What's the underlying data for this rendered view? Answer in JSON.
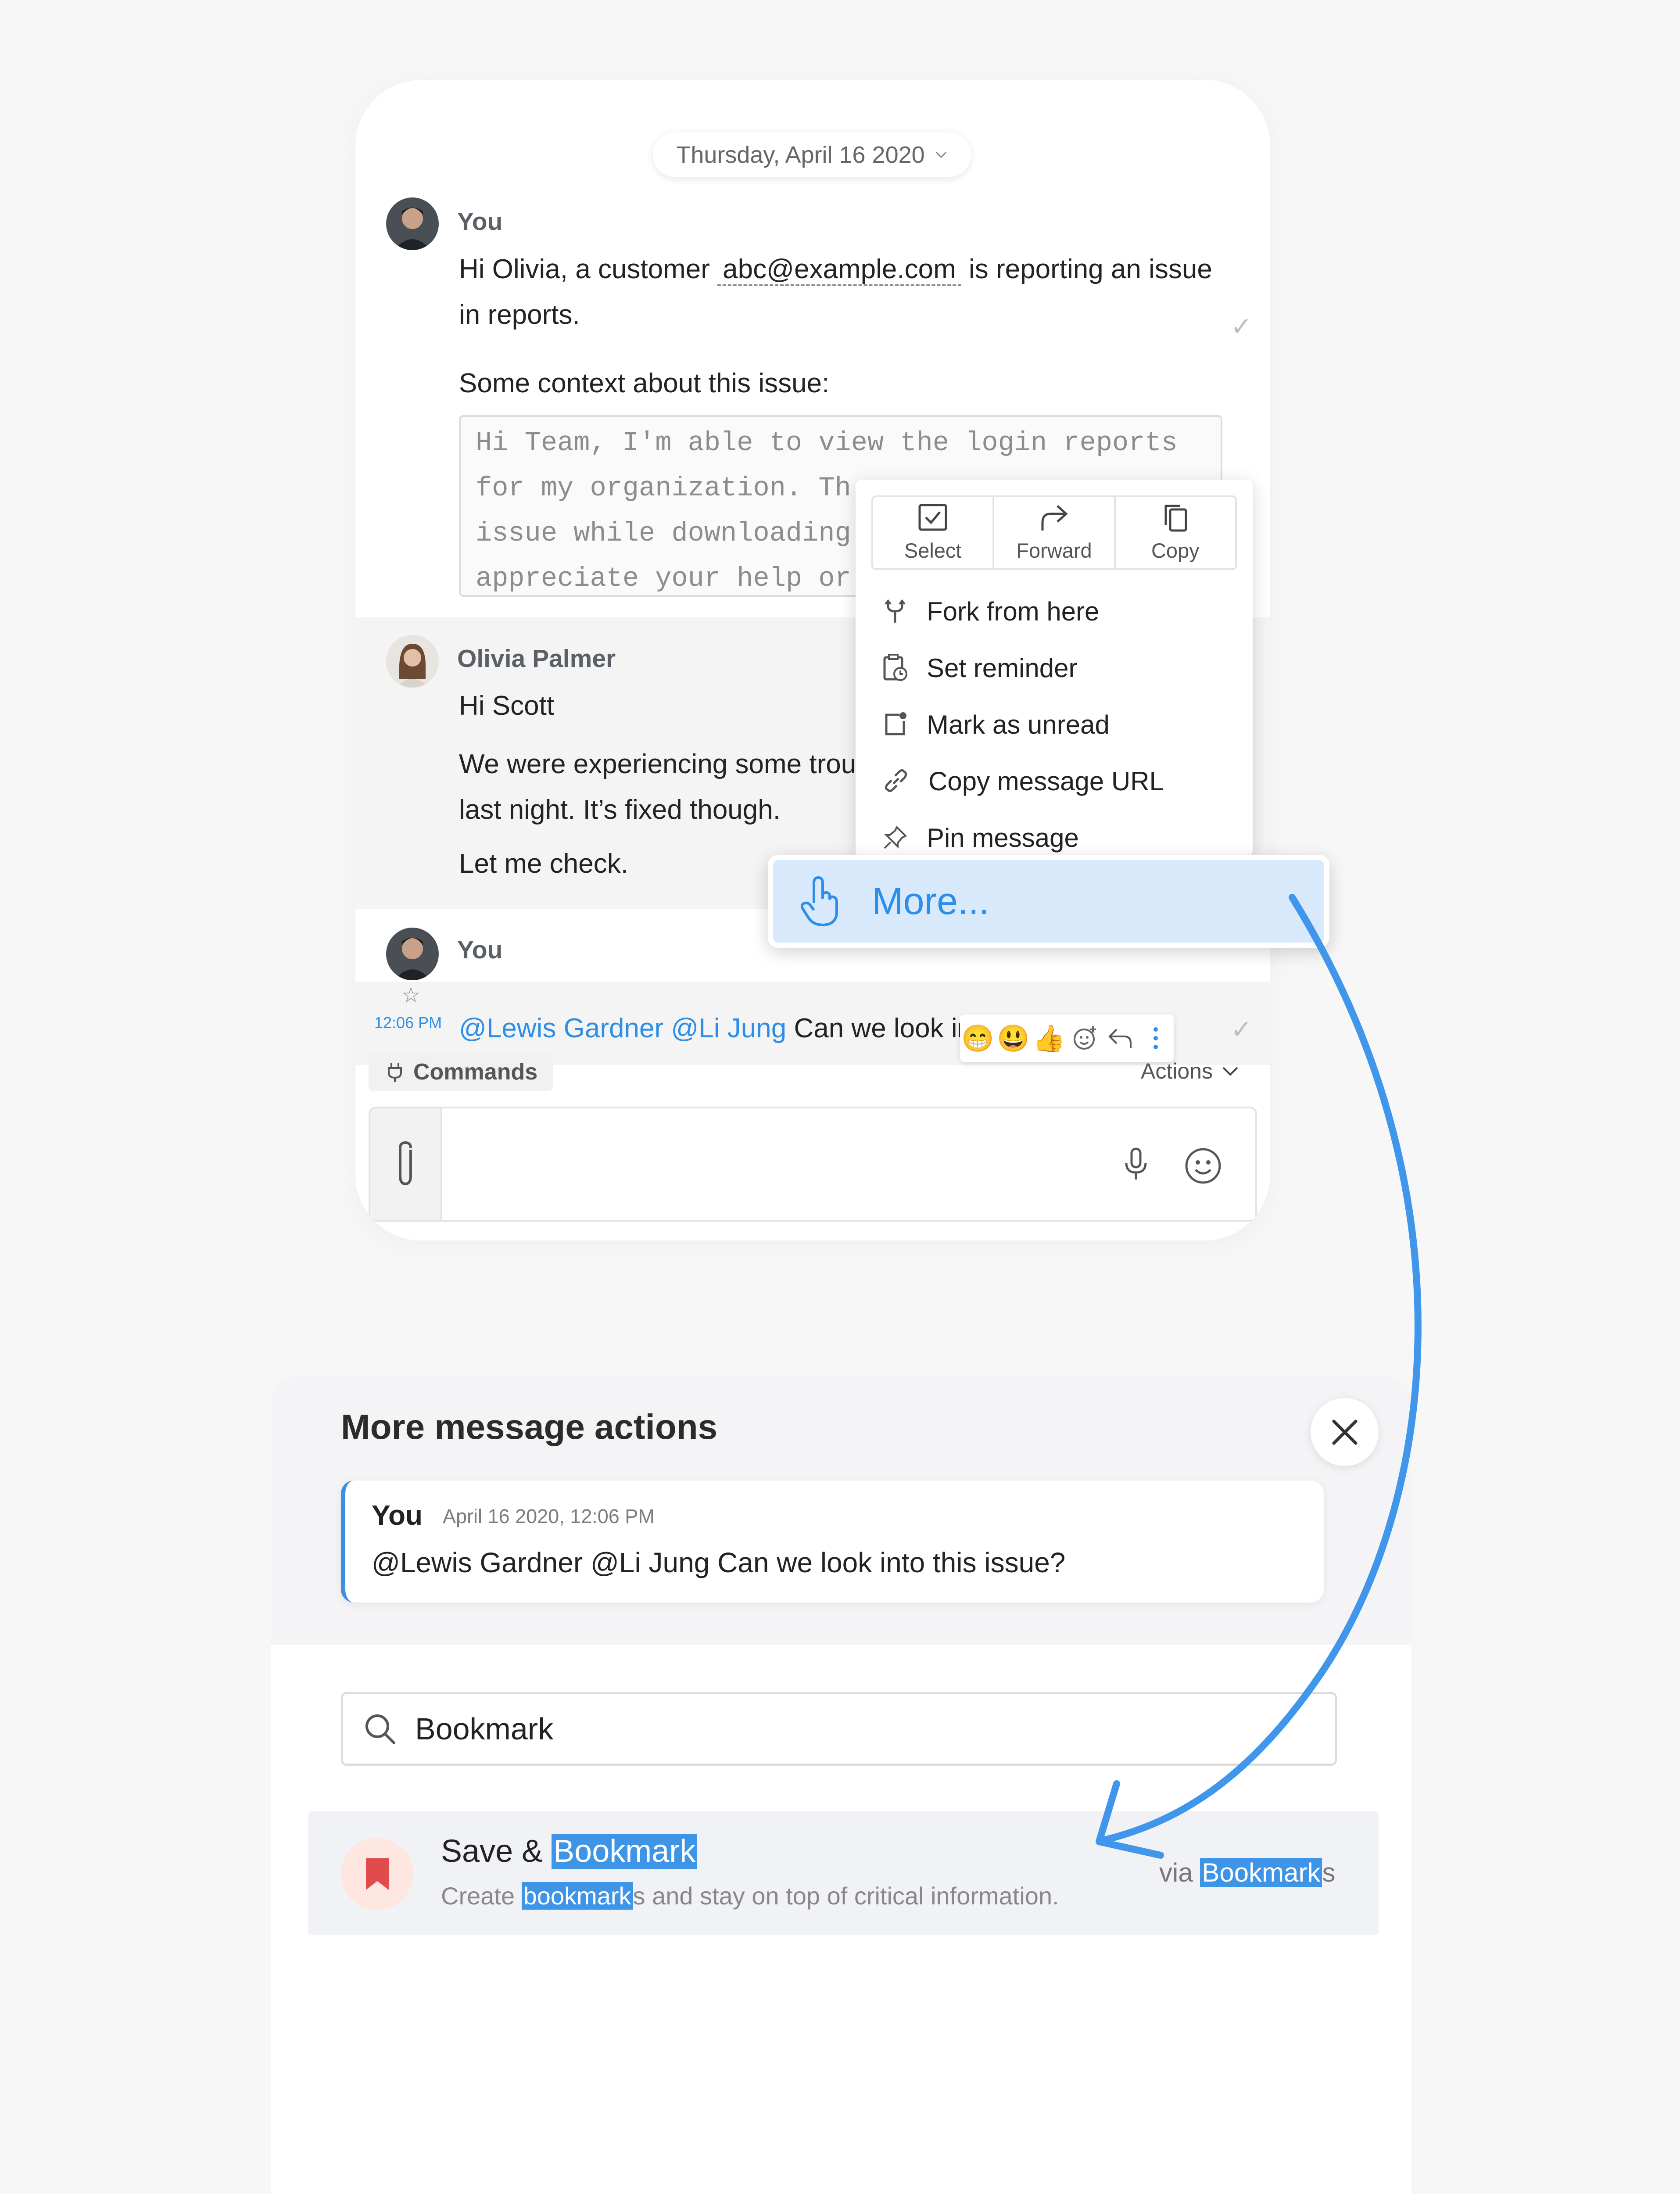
{
  "chat": {
    "date_label": "Thursday, April 16 2020",
    "messages": [
      {
        "sender": "You",
        "text_before": "Hi Olivia, a customer ",
        "email": "abc@example.com",
        "text_after": " is reporting an issue",
        "text_line2": "in reports.",
        "context_label": "Some context about this issue:",
        "quote_lines": [
          "Hi Team, I'm able to view the login reports",
          "for my organization. Th",
          "issue while downloading",
          "appreciate your help or"
        ]
      },
      {
        "sender": "Olivia Palmer",
        "line1": "Hi Scott",
        "line2": "We were experiencing some trou",
        "line3": "last night. It’s fixed though.",
        "line4": "Let me check."
      },
      {
        "sender": "You",
        "time": "12:06 PM",
        "mention1": "@Lewis Gardner",
        "mention2": "@Li Jung",
        "text": " Can we look into this issue?"
      }
    ],
    "reactions": [
      "😁",
      "😃",
      "👍"
    ],
    "commands_label": "Commands",
    "actions_label": "Actions",
    "colors": {
      "accent": "#2e8de6"
    }
  },
  "context_menu": {
    "top_actions": [
      "Select",
      "Forward",
      "Copy"
    ],
    "items": [
      "Fork from here",
      "Set reminder",
      "Mark as unread",
      "Copy message URL",
      "Pin message"
    ],
    "more_label": "More..."
  },
  "panel": {
    "title": "More message actions",
    "preview": {
      "sender": "You",
      "date": "April 16 2020, 12:06 PM",
      "text": "@Lewis Gardner @Li Jung Can we look into this issue?"
    },
    "search_value": "Bookmark",
    "result": {
      "title_prefix": "Save & ",
      "title_highlight": "Bookmark",
      "desc_prefix": "Create ",
      "desc_highlight": "bookmark",
      "desc_suffix": "s and stay on top of critical information.",
      "via_prefix": "via ",
      "via_highlight": "Bookmark",
      "via_suffix": "s"
    }
  }
}
